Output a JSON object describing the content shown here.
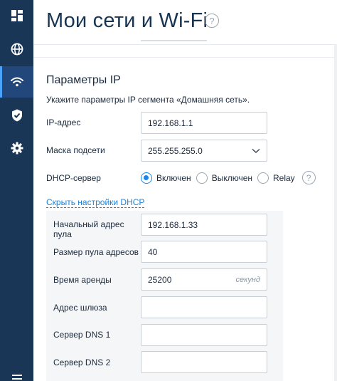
{
  "header": {
    "title": "Мои сети и Wi-Fi",
    "help_glyph": "?"
  },
  "sidebar": {
    "items": [
      {
        "icon": "dashboard-icon",
        "active": false
      },
      {
        "icon": "globe-icon",
        "active": false
      },
      {
        "icon": "wifi-icon",
        "active": true
      },
      {
        "icon": "shield-check-icon",
        "active": false
      },
      {
        "icon": "gear-icon",
        "active": false
      },
      {
        "icon": "menu-icon",
        "active": false
      }
    ]
  },
  "section": {
    "title": "Параметры IP",
    "description": "Укажите параметры IP сегмента «Домашняя сеть»."
  },
  "ip": {
    "label": "IP-адрес",
    "value": "192.168.1.1"
  },
  "mask": {
    "label": "Маска подсети",
    "value": "255.255.255.0"
  },
  "dhcp": {
    "label": "DHCP-сервер",
    "options": [
      "Включен",
      "Выключен",
      "Relay"
    ],
    "selected": "Включен",
    "help_glyph": "?",
    "toggle_link": "Скрыть настройки DHCP"
  },
  "dhcp_settings": {
    "pool_start": {
      "label": "Начальный адрес пула",
      "value": "192.168.1.33"
    },
    "pool_size": {
      "label": "Размер пула адресов",
      "value": "40"
    },
    "lease_time": {
      "label": "Время аренды",
      "value": "25200",
      "unit": "секунд"
    },
    "gateway": {
      "label": "Адрес шлюза",
      "value": ""
    },
    "dns1": {
      "label": "Сервер DNS 1",
      "value": ""
    },
    "dns2": {
      "label": "Сервер DNS 2",
      "value": ""
    }
  },
  "colors": {
    "sidebar_bg": "#193657",
    "sidebar_active": "#22477a",
    "accent": "#1b86e8",
    "link": "#2182d6"
  }
}
